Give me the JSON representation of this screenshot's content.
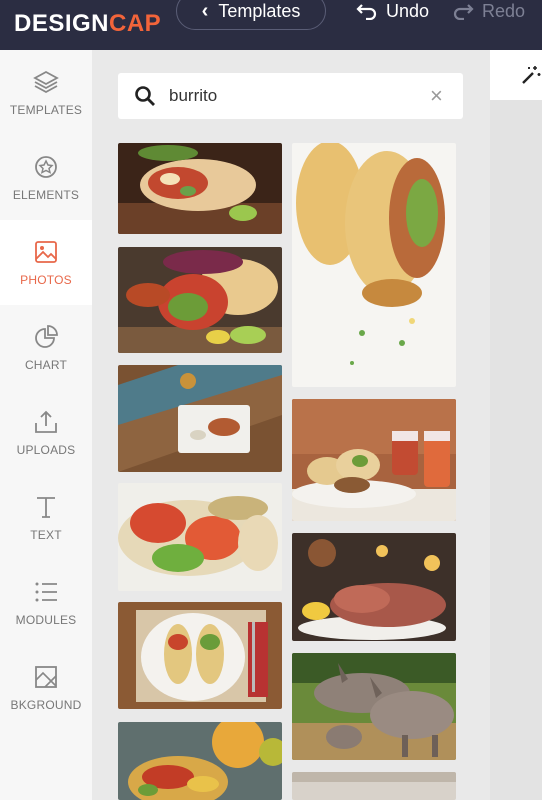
{
  "header": {
    "logo_part1": "DESIGN",
    "logo_part2": "CAP",
    "templates_label": "Templates",
    "undo_label": "Undo",
    "redo_label": "Redo"
  },
  "sidebar": {
    "items": [
      {
        "label": "TEMPLATES",
        "icon": "layers-icon",
        "active": false
      },
      {
        "label": "ELEMENTS",
        "icon": "elements-icon",
        "active": false
      },
      {
        "label": "PHOTOS",
        "icon": "image-icon",
        "active": true
      },
      {
        "label": "CHART",
        "icon": "pie-chart-icon",
        "active": false
      },
      {
        "label": "UPLOADS",
        "icon": "upload-icon",
        "active": false
      },
      {
        "label": "TEXT",
        "icon": "text-icon",
        "active": false
      },
      {
        "label": "MODULES",
        "icon": "list-icon",
        "active": false
      },
      {
        "label": "BKGROUND",
        "icon": "background-icon",
        "active": false
      }
    ]
  },
  "search": {
    "value": "burrito"
  },
  "photos": [
    {
      "subject": "burrito-halves-on-board"
    },
    {
      "subject": "two-tacos-top-view"
    },
    {
      "subject": "burrito-with-salsa-and-lime"
    },
    {
      "subject": "plate-on-wooden-table"
    },
    {
      "subject": "burritos-on-plate-with-jars"
    },
    {
      "subject": "veggie-wrap-closeup"
    },
    {
      "subject": "shredded-meat-platter"
    },
    {
      "subject": "wraps-on-white-plate"
    },
    {
      "subject": "donkeys-in-field"
    },
    {
      "subject": "tacos-with-mango"
    },
    {
      "subject": "partial-photo"
    }
  ],
  "colors": {
    "topbar": "#2b2d42",
    "accent": "#f2643a",
    "active_nav": "#e8684a"
  }
}
